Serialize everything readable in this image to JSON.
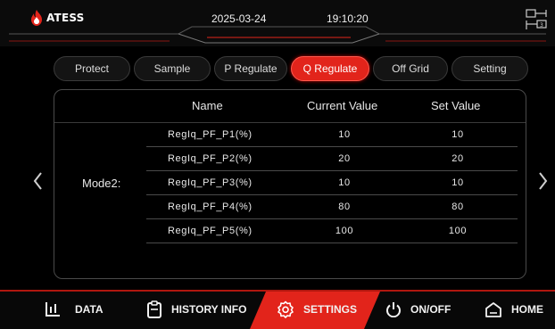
{
  "header": {
    "logo_text": "ATESS",
    "date": "2025-03-24",
    "time": "19:10:20",
    "icons": [
      "flame-logo-icon",
      "topology-icon"
    ]
  },
  "tabs": [
    {
      "label": "Protect",
      "active": false
    },
    {
      "label": "Sample",
      "active": false
    },
    {
      "label": "P Regulate",
      "active": false
    },
    {
      "label": "Q Regulate",
      "active": true
    },
    {
      "label": "Off Grid",
      "active": false
    },
    {
      "label": "Setting",
      "active": false
    }
  ],
  "table": {
    "columns": {
      "name": "Name",
      "current": "Current Value",
      "set": "Set Value"
    },
    "mode_label": "Mode2:",
    "rows": [
      {
        "name": "RegIq_PF_P1(%)",
        "current": "10",
        "set": "10"
      },
      {
        "name": "RegIq_PF_P2(%)",
        "current": "20",
        "set": "20"
      },
      {
        "name": "RegIq_PF_P3(%)",
        "current": "10",
        "set": "10"
      },
      {
        "name": "RegIq_PF_P4(%)",
        "current": "80",
        "set": "80"
      },
      {
        "name": "RegIq_PF_P5(%)",
        "current": "100",
        "set": "100"
      }
    ]
  },
  "nav": {
    "data": "DATA",
    "history": "HISTORY INFO",
    "settings": "SETTINGS",
    "onoff": "ON/OFF",
    "home": "HOME",
    "active": "settings"
  },
  "colors": {
    "accent": "#e2241b",
    "background": "#000000",
    "border": "#4a4a4a"
  }
}
